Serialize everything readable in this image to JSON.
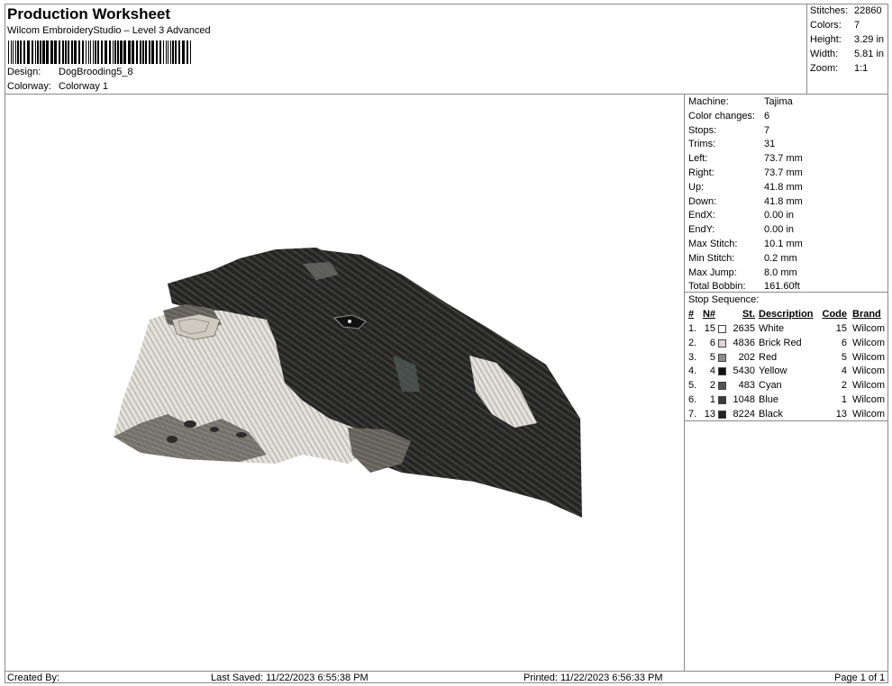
{
  "header": {
    "title": "Production Worksheet",
    "subtitle": "Wilcom EmbroideryStudio – Level 3 Advanced",
    "design_label": "Design:",
    "design_value": "DogBrooding5_8",
    "colorway_label": "Colorway:",
    "colorway_value": "Colorway 1"
  },
  "stats": [
    {
      "label": "Stitches:",
      "value": "22860"
    },
    {
      "label": "Colors:",
      "value": "7"
    },
    {
      "label": "Height:",
      "value": "3.29 in"
    },
    {
      "label": "Width:",
      "value": "5.81 in"
    },
    {
      "label": "Zoom:",
      "value": "1:1"
    }
  ],
  "properties": [
    {
      "label": "Machine:",
      "value": "Tajima"
    },
    {
      "label": "Color changes:",
      "value": "6"
    },
    {
      "label": "Stops:",
      "value": "7"
    },
    {
      "label": "Trims:",
      "value": "31"
    },
    {
      "label": "Left:",
      "value": "73.7 mm"
    },
    {
      "label": "Right:",
      "value": "73.7 mm"
    },
    {
      "label": "Up:",
      "value": "41.8 mm"
    },
    {
      "label": "Down:",
      "value": "41.8 mm"
    },
    {
      "label": "EndX:",
      "value": "0.00 in"
    },
    {
      "label": "EndY:",
      "value": "0.00 in"
    },
    {
      "label": "Max Stitch:",
      "value": "10.1 mm"
    },
    {
      "label": "Min Stitch:",
      "value": "0.2 mm"
    },
    {
      "label": "Max Jump:",
      "value": "8.0 mm"
    },
    {
      "label": "Total Bobbin:",
      "value": "161.60ft"
    }
  ],
  "stop_sequence": {
    "title": "Stop Sequence:",
    "headers": {
      "idx": "#",
      "n": "N#",
      "st": "St.",
      "desc": "Description",
      "code": "Code",
      "brand": "Brand"
    },
    "rows": [
      {
        "idx": "1.",
        "n": "15",
        "swatch": "#ffffff",
        "st": "2635",
        "desc": "White",
        "code": "15",
        "brand": "Wilcom"
      },
      {
        "idx": "2.",
        "n": "6",
        "swatch": "#e2d6d6",
        "st": "4836",
        "desc": "Brick Red",
        "code": "6",
        "brand": "Wilcom"
      },
      {
        "idx": "3.",
        "n": "5",
        "swatch": "#8c8c8c",
        "st": "202",
        "desc": "Red",
        "code": "5",
        "brand": "Wilcom"
      },
      {
        "idx": "4.",
        "n": "4",
        "swatch": "#111111",
        "st": "5430",
        "desc": "Yellow",
        "code": "4",
        "brand": "Wilcom"
      },
      {
        "idx": "5.",
        "n": "2",
        "swatch": "#555555",
        "st": "483",
        "desc": "Cyan",
        "code": "2",
        "brand": "Wilcom"
      },
      {
        "idx": "6.",
        "n": "1",
        "swatch": "#3b3b3b",
        "st": "1048",
        "desc": "Blue",
        "code": "1",
        "brand": "Wilcom"
      },
      {
        "idx": "7.",
        "n": "13",
        "swatch": "#222222",
        "st": "8224",
        "desc": "Black",
        "code": "13",
        "brand": "Wilcom"
      }
    ]
  },
  "footer": {
    "created_by": "Created By:",
    "last_saved": "Last Saved: 11/22/2023 6:55:38 PM",
    "printed": "Printed: 11/22/2023 6:56:33 PM",
    "page": "Page 1 of 1"
  }
}
